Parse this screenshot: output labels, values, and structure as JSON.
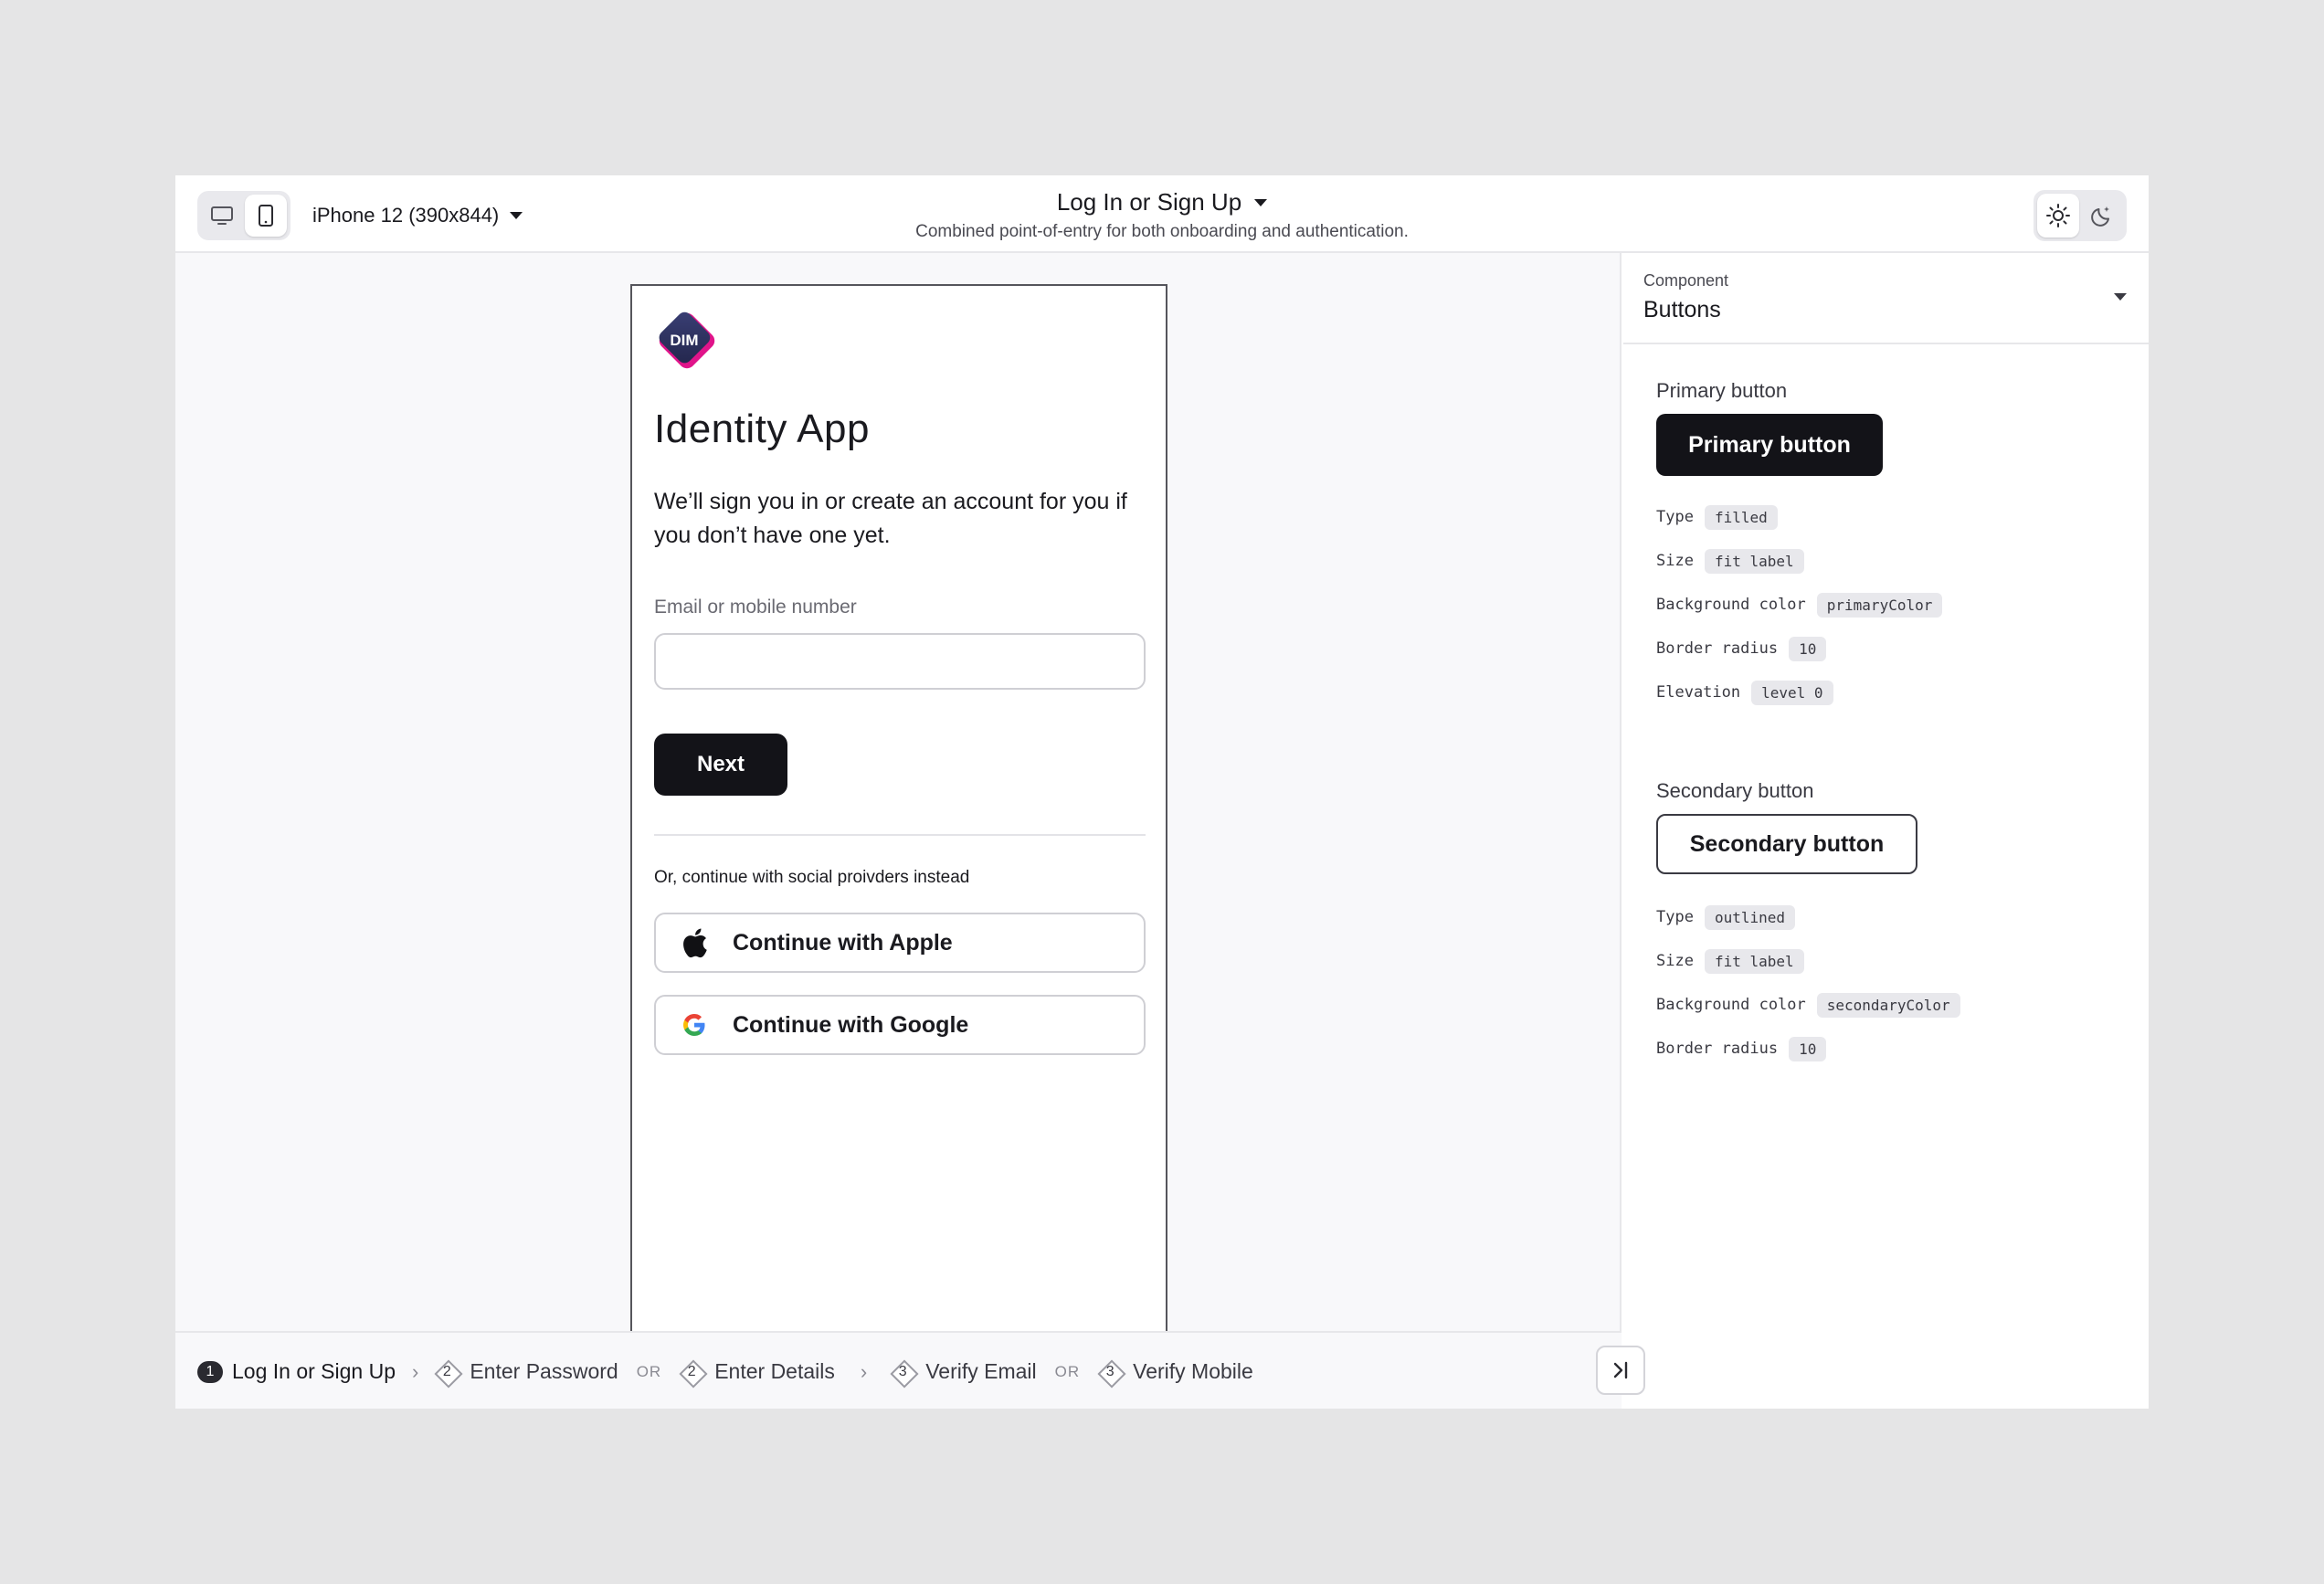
{
  "topbar": {
    "device": "iPhone 12 (390x844)",
    "screen_title": "Log In or Sign Up",
    "screen_subtitle": "Combined point-of-entry for both onboarding and authentication.",
    "icons": {
      "desktop": "desktop-icon",
      "mobile": "mobile-icon",
      "light": "sun-icon",
      "dark": "moon-icon"
    }
  },
  "phone": {
    "logo_text": "DIM",
    "title": "Identity App",
    "description": "We’ll sign you in or create an account for you if you don’t have one yet.",
    "field_label": "Email or mobile number",
    "field_value": "",
    "field_placeholder": "",
    "next_label": "Next",
    "social_caption": "Or, continue with social proivders instead",
    "apple_label": "Continue with Apple",
    "google_label": "Continue with Google"
  },
  "panel": {
    "component_label": "Component",
    "component_value": "Buttons",
    "primary": {
      "title": "Primary button",
      "demo_label": "Primary button",
      "props": [
        {
          "key": "Type",
          "value": "filled"
        },
        {
          "key": "Size",
          "value": "fit label"
        },
        {
          "key": "Background color",
          "value": "primaryColor"
        },
        {
          "key": "Border radius",
          "value": "10"
        },
        {
          "key": "Elevation",
          "value": "level 0"
        }
      ]
    },
    "secondary": {
      "title": "Secondary button",
      "demo_label": "Secondary button",
      "props": [
        {
          "key": "Type",
          "value": "outlined"
        },
        {
          "key": "Size",
          "value": "fit label"
        },
        {
          "key": "Background color",
          "value": "secondaryColor"
        },
        {
          "key": "Border radius",
          "value": "10"
        }
      ]
    }
  },
  "steps": [
    {
      "num": "1",
      "label": "Log In or Sign Up"
    },
    {
      "num": "2",
      "label": "Enter Password"
    },
    {
      "num": "2",
      "label": "Enter Details"
    },
    {
      "num": "3",
      "label": "Verify Email"
    },
    {
      "num": "3",
      "label": "Verify Mobile"
    }
  ],
  "step_separators": {
    "or": "OR"
  },
  "colors": {
    "primary": "#131318",
    "brand_pink": "#e0148a",
    "brand_navy": "#2b2f5e",
    "canvas": "#f8f8fa"
  }
}
